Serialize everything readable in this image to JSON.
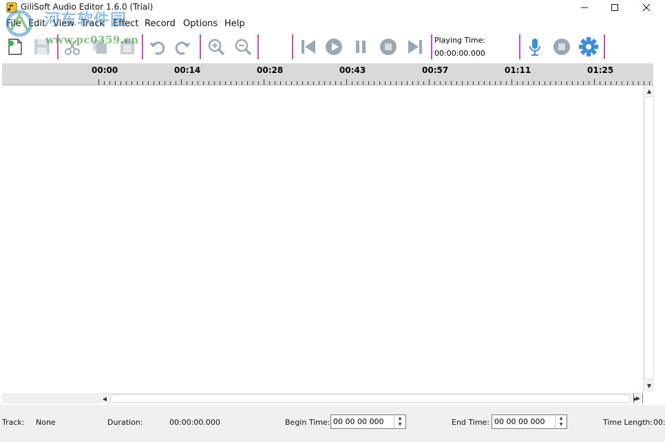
{
  "window": {
    "title": "GiliSoft Audio Editor 1.6.0 (Trial)"
  },
  "watermark": {
    "line1": "河东软件园",
    "line2": "www.pc0359.cn"
  },
  "menu": [
    "File",
    "Edit",
    "View",
    "Track",
    "Effect",
    "Record",
    "Options",
    "Help"
  ],
  "playing_time": {
    "label": "Playing Time:",
    "value": "00:00:00.000"
  },
  "ruler": {
    "labels": [
      "00:00",
      "00:14",
      "00:28",
      "00:43",
      "00:57",
      "01:11",
      "01:25"
    ]
  },
  "status": {
    "track_label": "Track:",
    "track_value": "None",
    "duration_label": "Duration:",
    "duration_value": "00:00:00.000",
    "begin_label": "Begin Time:",
    "begin_value": "00 00 00 000",
    "end_label": "End Time:",
    "end_value": "00 00 00 000",
    "length_label": "Time Length:",
    "length_value": "00:"
  },
  "colors": {
    "separator": "#c84ac8",
    "icon_blue": "#3d8ed6",
    "icon_gray": "#9aa8b4"
  }
}
